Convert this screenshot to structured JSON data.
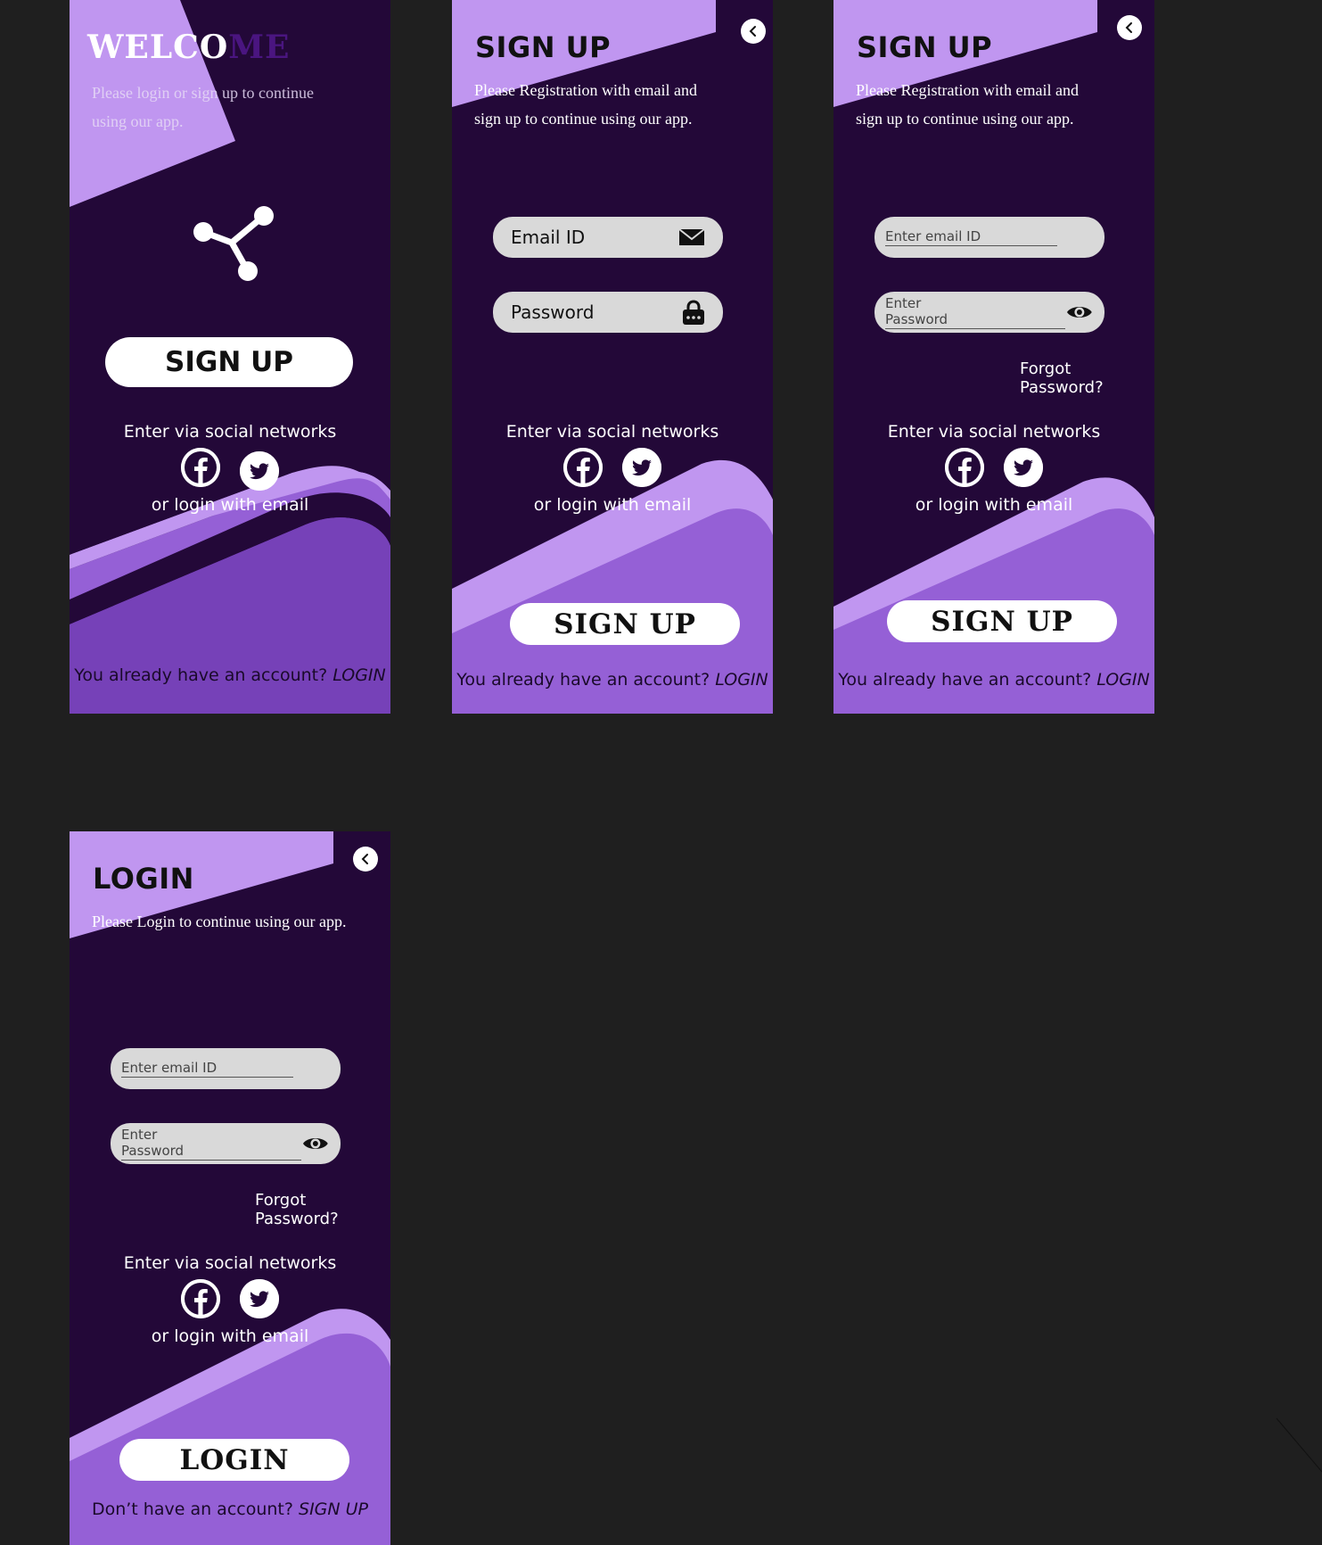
{
  "welcome": {
    "title_light": "WELCO",
    "title_dark": "ME",
    "subtitle_line1": "Please login or sign up to continue",
    "subtitle_line2": "using our app.",
    "signup_label": "SIGN UP",
    "social_label": "Enter via social networks",
    "or_email": "or login with email",
    "footer_text": "You already have an account?",
    "footer_link": "LOGIN"
  },
  "signup1": {
    "title": "SIGN UP",
    "subtitle_line1": "Please Registration with email and",
    "subtitle_line2": "sign up to continue using our app.",
    "email_label": "Email ID",
    "password_label": "Password",
    "social_label": "Enter via social networks",
    "or_email": "or login with email",
    "signup_label": "SIGN UP",
    "footer_text": "You already have an account?",
    "footer_link": "LOGIN"
  },
  "signup2": {
    "title": "SIGN UP",
    "subtitle_line1": "Please Registration with email and",
    "subtitle_line2": "sign up to continue using our app.",
    "email_placeholder": "Enter email ID",
    "password_placeholder": "Enter Password",
    "forgot": "Forgot Password?",
    "social_label": "Enter via social networks",
    "or_email": "or login with email",
    "signup_label": "SIGN UP",
    "footer_text": "You already have an account?",
    "footer_link": "LOGIN"
  },
  "login": {
    "title": "LOGIN",
    "subtitle": "Please Login to continue using our app.",
    "email_placeholder": "Enter email ID",
    "password_placeholder": "Enter Password",
    "forgot": "Forgot Password?",
    "social_label": "Enter via social networks",
    "or_email": "or login with email",
    "login_label": "LOGIN",
    "footer_text": "Don’t have an account?",
    "footer_link": "SIGN UP"
  },
  "icons": {
    "share": "share-icon",
    "facebook": "facebook-icon",
    "twitter": "twitter-icon",
    "mail": "mail-icon",
    "lock": "lock-icon",
    "eye": "eye-icon",
    "back": "chevron-left-icon"
  },
  "colors": {
    "dark_purple": "#230838",
    "light_purple": "#c096f0",
    "mid_purple": "#9560d6",
    "deep_wave": "#7641b8"
  }
}
